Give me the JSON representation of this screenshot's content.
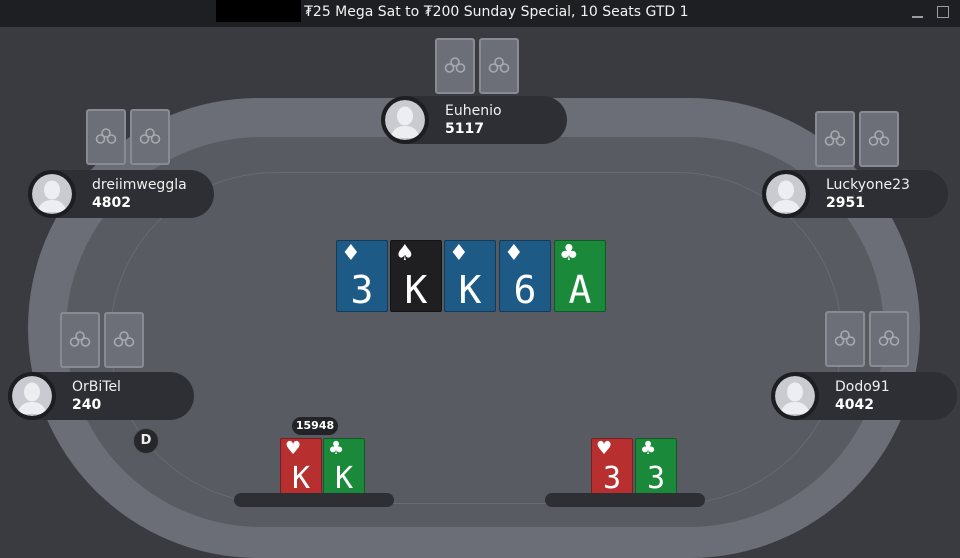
{
  "window": {
    "title": "₮25 Mega Sat to ₮200 Sunday Special, 10 Seats GTD 1",
    "minimize_icon": "minimize-icon",
    "maximize_icon": "maximize-icon"
  },
  "colors": {
    "spade": "#1f1f22",
    "heart": "#b82f2f",
    "diamond": "#1e5a86",
    "club": "#1a8a3a"
  },
  "seats": [
    {
      "name": "Euhenio",
      "stack": "5117"
    },
    {
      "name": "dreiimweggla",
      "stack": "4802"
    },
    {
      "name": "Luckyone23",
      "stack": "2951"
    },
    {
      "name": "OrBiTel",
      "stack": "240"
    },
    {
      "name": "Dodo91",
      "stack": "4042"
    }
  ],
  "board": [
    {
      "rank": "3",
      "suit": "♦",
      "suit_name": "diamond"
    },
    {
      "rank": "K",
      "suit": "♠",
      "suit_name": "spade"
    },
    {
      "rank": "K",
      "suit": "♦",
      "suit_name": "diamond"
    },
    {
      "rank": "6",
      "suit": "♦",
      "suit_name": "diamond"
    },
    {
      "rank": "A",
      "suit": "♣",
      "suit_name": "club"
    }
  ],
  "hands": [
    {
      "bet": "15948",
      "cards": [
        {
          "rank": "K",
          "suit": "♥",
          "suit_name": "heart"
        },
        {
          "rank": "K",
          "suit": "♣",
          "suit_name": "club"
        }
      ]
    },
    {
      "cards": [
        {
          "rank": "3",
          "suit": "♥",
          "suit_name": "heart"
        },
        {
          "rank": "3",
          "suit": "♣",
          "suit_name": "club"
        }
      ]
    }
  ],
  "dealer_button": "D"
}
